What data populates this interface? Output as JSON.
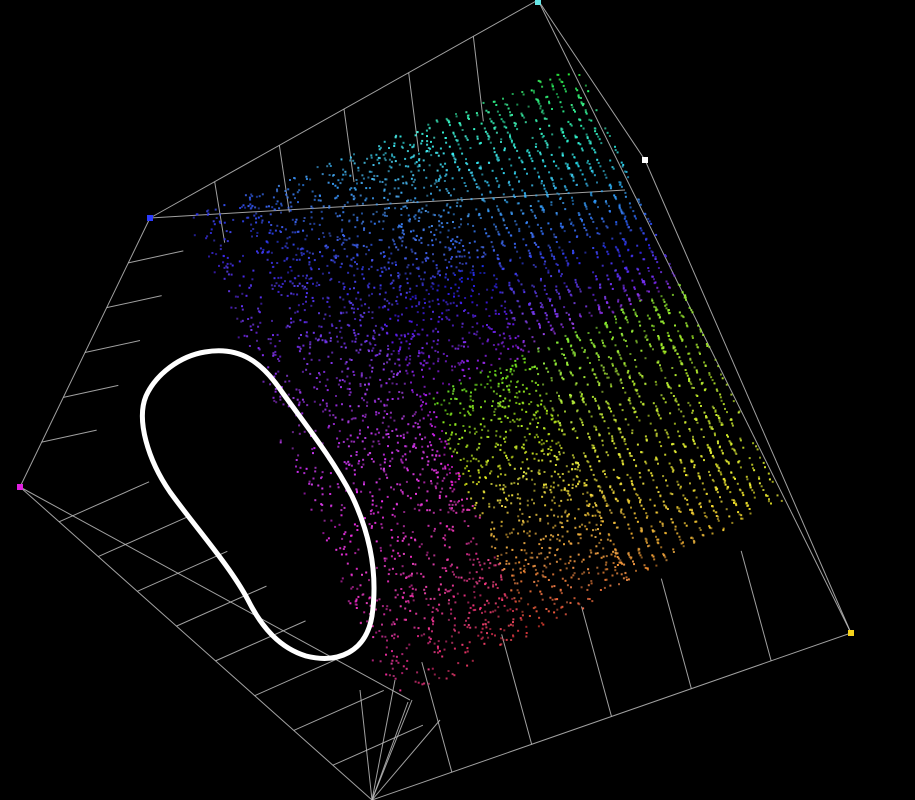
{
  "colors": {
    "background": "#000000",
    "cube_edge": "#bdbdbd",
    "annotation": "#ffffff",
    "marker_blue": "#2b3bff",
    "marker_magenta": "#e020e0",
    "marker_yellow": "#f5d21c",
    "marker_white": "#ffffff",
    "marker_cyan": "#66e6e6"
  },
  "corner_markers": [
    {
      "name": "corner-marker-blue",
      "color_key": "marker_blue"
    },
    {
      "name": "corner-marker-magenta",
      "color_key": "marker_magenta"
    },
    {
      "name": "corner-marker-yellow",
      "color_key": "marker_yellow"
    },
    {
      "name": "corner-marker-white",
      "color_key": "marker_white"
    },
    {
      "name": "corner-marker-cyan",
      "color_key": "marker_cyan"
    }
  ],
  "annotation": {
    "shape": "hand-drawn-ellipse",
    "color_key": "annotation"
  },
  "point_cloud": {
    "description_colors": [
      "#3a3aff",
      "#9a4cff",
      "#e040e0",
      "#ff3030",
      "#ff9a30",
      "#f0d040",
      "#80ff60",
      "#60e0e0",
      "#6aaaff"
    ]
  }
}
